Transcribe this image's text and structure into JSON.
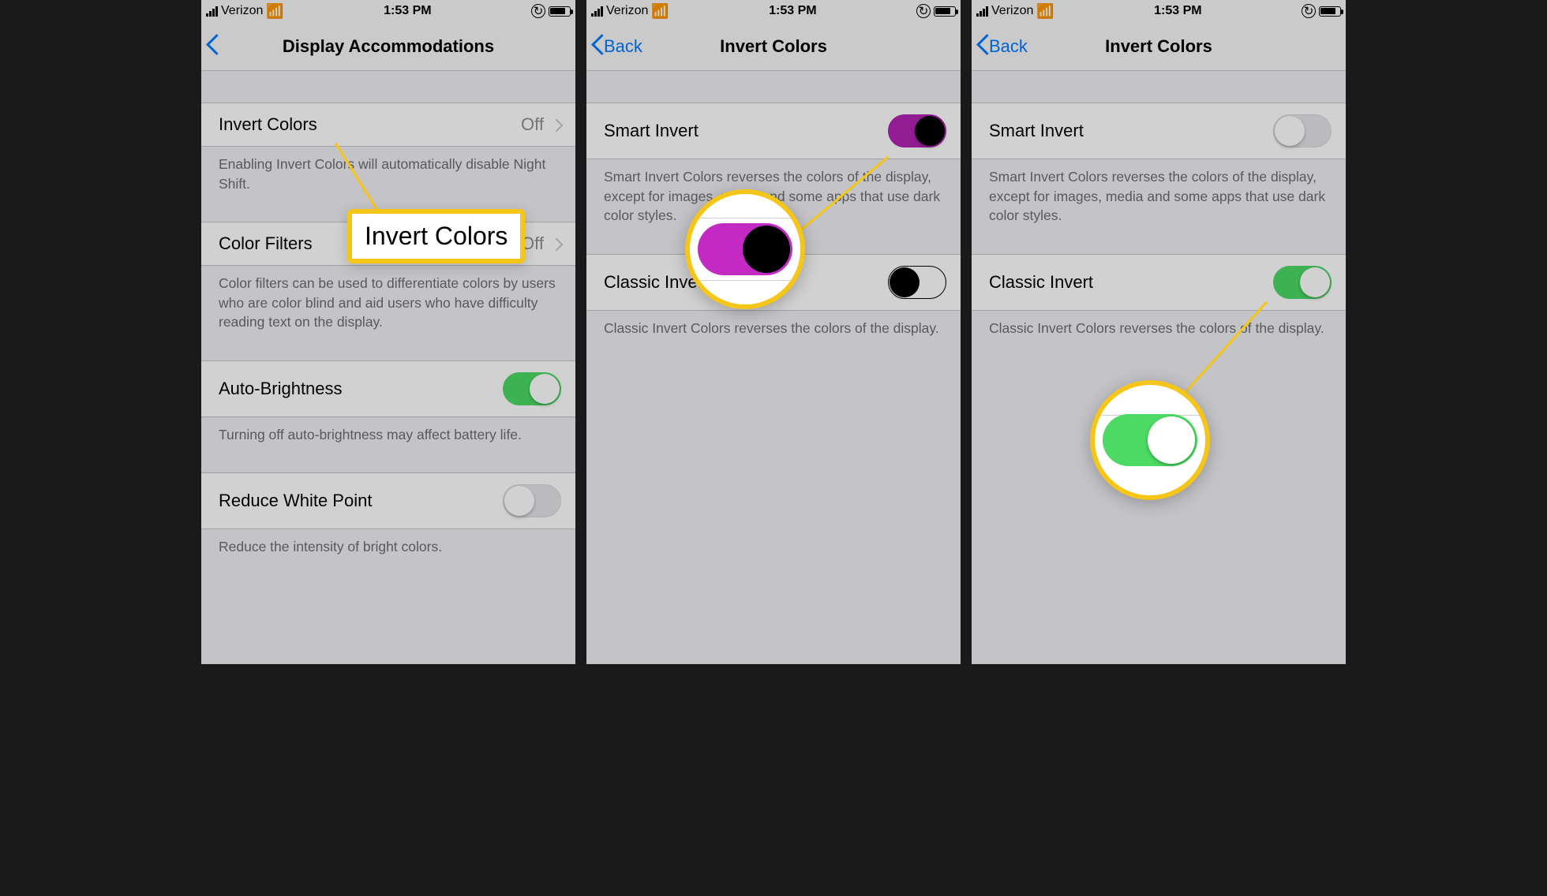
{
  "statusbar": {
    "carrier": "Verizon",
    "time": "1:53 PM"
  },
  "phone1": {
    "nav_title": "Display Accommodations",
    "rows": {
      "invert_label": "Invert Colors",
      "invert_value": "Off",
      "invert_footer": "Enabling Invert Colors will automatically disable Night Shift.",
      "colorfilters_label": "Color Filters",
      "colorfilters_value": "Off",
      "colorfilters_footer": "Color filters can be used to differentiate colors by users who are color blind and aid users who have difficulty reading text on the display.",
      "autobright_label": "Auto-Brightness",
      "autobright_footer": "Turning off auto-brightness may affect battery life.",
      "reducewhite_label": "Reduce White Point",
      "reducewhite_footer": "Reduce the intensity of bright colors."
    },
    "callout_text": "Invert Colors"
  },
  "phone2": {
    "back_label": "Back",
    "nav_title": "Invert Colors",
    "smart_label": "Smart Invert",
    "smart_footer": "Smart Invert Colors reverses the colors of the display, except for images, media and some apps that use dark color styles.",
    "classic_label": "Classic Invert",
    "classic_footer": "Classic Invert Colors reverses the colors of the display."
  },
  "phone3": {
    "back_label": "Back",
    "nav_title": "Invert Colors",
    "smart_label": "Smart Invert",
    "smart_footer": "Smart Invert Colors reverses the colors of the display, except for images, media and some apps that use dark color styles.",
    "classic_label": "Classic Invert",
    "classic_footer": "Classic Invert Colors reverses the colors of the display."
  },
  "toggles": {
    "phone1_autobright": true,
    "phone1_reducewhite": false,
    "phone2_smart": true,
    "phone2_classic": false,
    "phone3_smart": false,
    "phone3_classic": true
  }
}
